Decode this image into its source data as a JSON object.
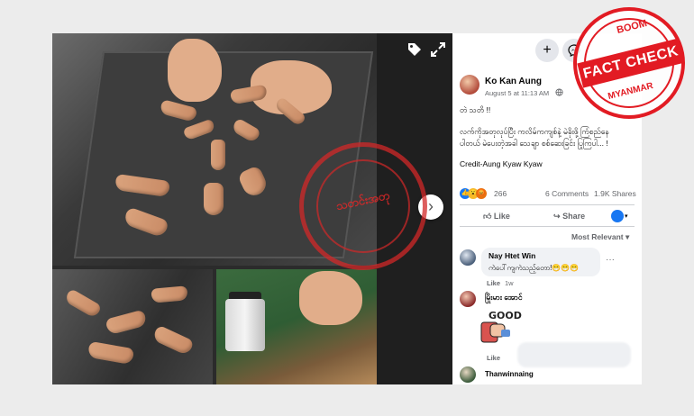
{
  "post": {
    "author": "Ko Kan Aung",
    "timestamp": "August 5 at 11:13 AM",
    "privacy_icon": "globe-icon",
    "more_icon": "ellipsis-icon",
    "line1": "တဲ သတိ !!",
    "line2": "လက်ကိုအတုလုပ်ပြီး ကလိမ်ကကျစ်နဲ့ မဲခိုးဖို့ ကြံစည်နေ",
    "line3": "ပါတယ် မဲပေးတဲ့အခါ သေချာ စစ်ဆေးခြင်း ပြုကြပါ... !",
    "credit": "Credit-Aung Kyaw Kyaw",
    "reaction_count": "266",
    "comments": "6 Comments",
    "shares": "1.9K Shares",
    "like_label": "Like",
    "share_label": "Share",
    "sort_label": "Most Relevant"
  },
  "comments": [
    {
      "name": "Nay Htet Win",
      "text": "ကဲပေါ်ကျကဲသည့်တော!😁😁😁",
      "like": "Like",
      "time": "1w"
    },
    {
      "name": "မြိုးမား အောင်",
      "sticker_text": "GOOD",
      "like": "Like"
    },
    {
      "name": "Thanwinnaing"
    }
  ],
  "header_buttons": {
    "add": "+",
    "messenger_icon": "messenger-icon"
  },
  "photo": {
    "tag_icon": "tag-icon",
    "expand_icon": "expand-icon",
    "next_icon": "chevron-right-icon"
  },
  "watermark": {
    "text": "သတင်းအတု"
  },
  "badge": {
    "top": "BOOM",
    "main": "FACT CHECK",
    "bottom": "MYANMAR"
  },
  "colors": {
    "badge_red": "#e21b23",
    "fb_blue": "#1877f2"
  }
}
